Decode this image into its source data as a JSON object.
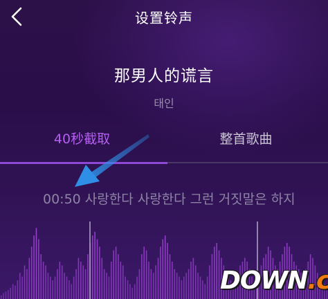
{
  "header": {
    "back_icon": "chevron-left-icon",
    "title": "设置铃声"
  },
  "song": {
    "title": "那男人的谎言",
    "artist": "태인"
  },
  "tabs": [
    {
      "label": "40秒截取",
      "active": true
    },
    {
      "label": "整首歌曲",
      "active": false
    }
  ],
  "lyric": {
    "time": "00:50",
    "text": "사랑한다 사랑한다 그런 거짓말은 하지"
  },
  "waveform": {
    "playhead_icon": "playhead-marker",
    "amplitudes": [
      0.05,
      0.08,
      0.1,
      0.12,
      0.15,
      0.2,
      0.18,
      0.25,
      0.35,
      0.3,
      0.45,
      0.4,
      0.55,
      0.7,
      0.85,
      0.95,
      0.8,
      0.6,
      0.5,
      0.45,
      0.35,
      0.3,
      0.25,
      0.3,
      0.4,
      0.5,
      0.45,
      0.35,
      0.3,
      0.25,
      0.2,
      0.3,
      0.4,
      0.55,
      0.5,
      0.45,
      0.4,
      0.6,
      0.75,
      0.85,
      0.9,
      0.8,
      0.7,
      0.55,
      0.4,
      0.35,
      0.3,
      0.5,
      0.65,
      0.7,
      0.6,
      0.5,
      0.45,
      0.3,
      0.25,
      0.2,
      0.15,
      0.2,
      0.3,
      0.4,
      0.6,
      0.7,
      0.65,
      0.5,
      0.4,
      0.35,
      0.45,
      0.55,
      0.7,
      0.8,
      0.85,
      0.75,
      0.6,
      0.5,
      0.4,
      0.35,
      0.3,
      0.25,
      0.3,
      0.35,
      0.4,
      0.5,
      0.55,
      0.45,
      0.35,
      0.3,
      0.25,
      0.2,
      0.3,
      0.45,
      0.6,
      0.7,
      0.75,
      0.65,
      0.55,
      0.45,
      0.35,
      0.3,
      0.25,
      0.2,
      0.3,
      0.35,
      0.45,
      0.5,
      0.55,
      0.5,
      0.4,
      0.3,
      0.25,
      0.2,
      0.3,
      0.45,
      0.55,
      0.6,
      0.7,
      0.65,
      0.55,
      0.45,
      0.4,
      0.5,
      0.6,
      0.7,
      0.75,
      0.7,
      0.6,
      0.5,
      0.45,
      0.4,
      0.35,
      0.3,
      0.4,
      0.5,
      0.6,
      0.55,
      0.45,
      0.35,
      0.3,
      0.25,
      0.2,
      0.15
    ],
    "bar_color": "#9a3fd0",
    "marker_color": "#bdb3cc"
  },
  "annotation": {
    "arrow_color": "#2f8fe6"
  },
  "watermark": {
    "main": "DOWN",
    "suffix": ".cc"
  },
  "colors": {
    "accent": "#b55ef2",
    "indicator": "#8e48d8",
    "muted_text": "#8e84a6"
  }
}
